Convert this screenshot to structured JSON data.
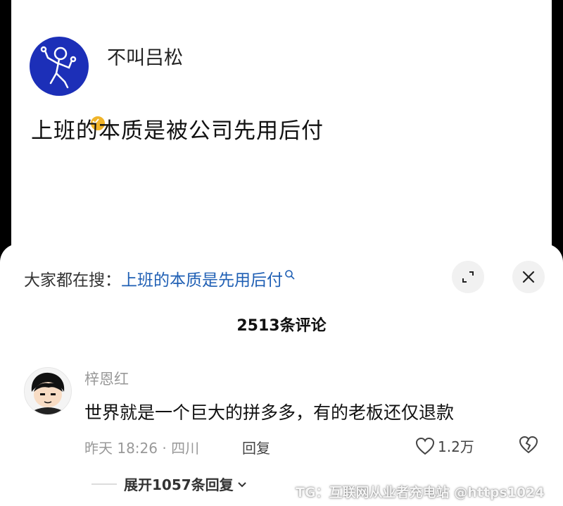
{
  "post": {
    "author": "不叫吕松",
    "text": "上班的本质是被公司先用后付"
  },
  "search": {
    "prefix": "大家都在搜：",
    "query": "上班的本质是先用后付"
  },
  "comments_header": {
    "count_label": "2513条评论"
  },
  "comment": {
    "author": "梓恩红",
    "text": "世界就是一个巨大的拼多多，有的老板还仅退款",
    "meta": "昨天 18:26 · 四川",
    "reply_label": "回复",
    "likes": "1.2万",
    "expand_label": "展开1057条回复"
  },
  "watermark": "TG：互联网从业者充电站 @https1024",
  "colors": {
    "avatar_bg": "#1c2fb8",
    "badge": "#f0b429",
    "link": "#1f5fb4"
  },
  "icons": [
    "verified-badge-icon",
    "search-icon",
    "expand-icon",
    "close-icon",
    "heart-icon",
    "broken-heart-icon",
    "chevron-down-icon"
  ]
}
